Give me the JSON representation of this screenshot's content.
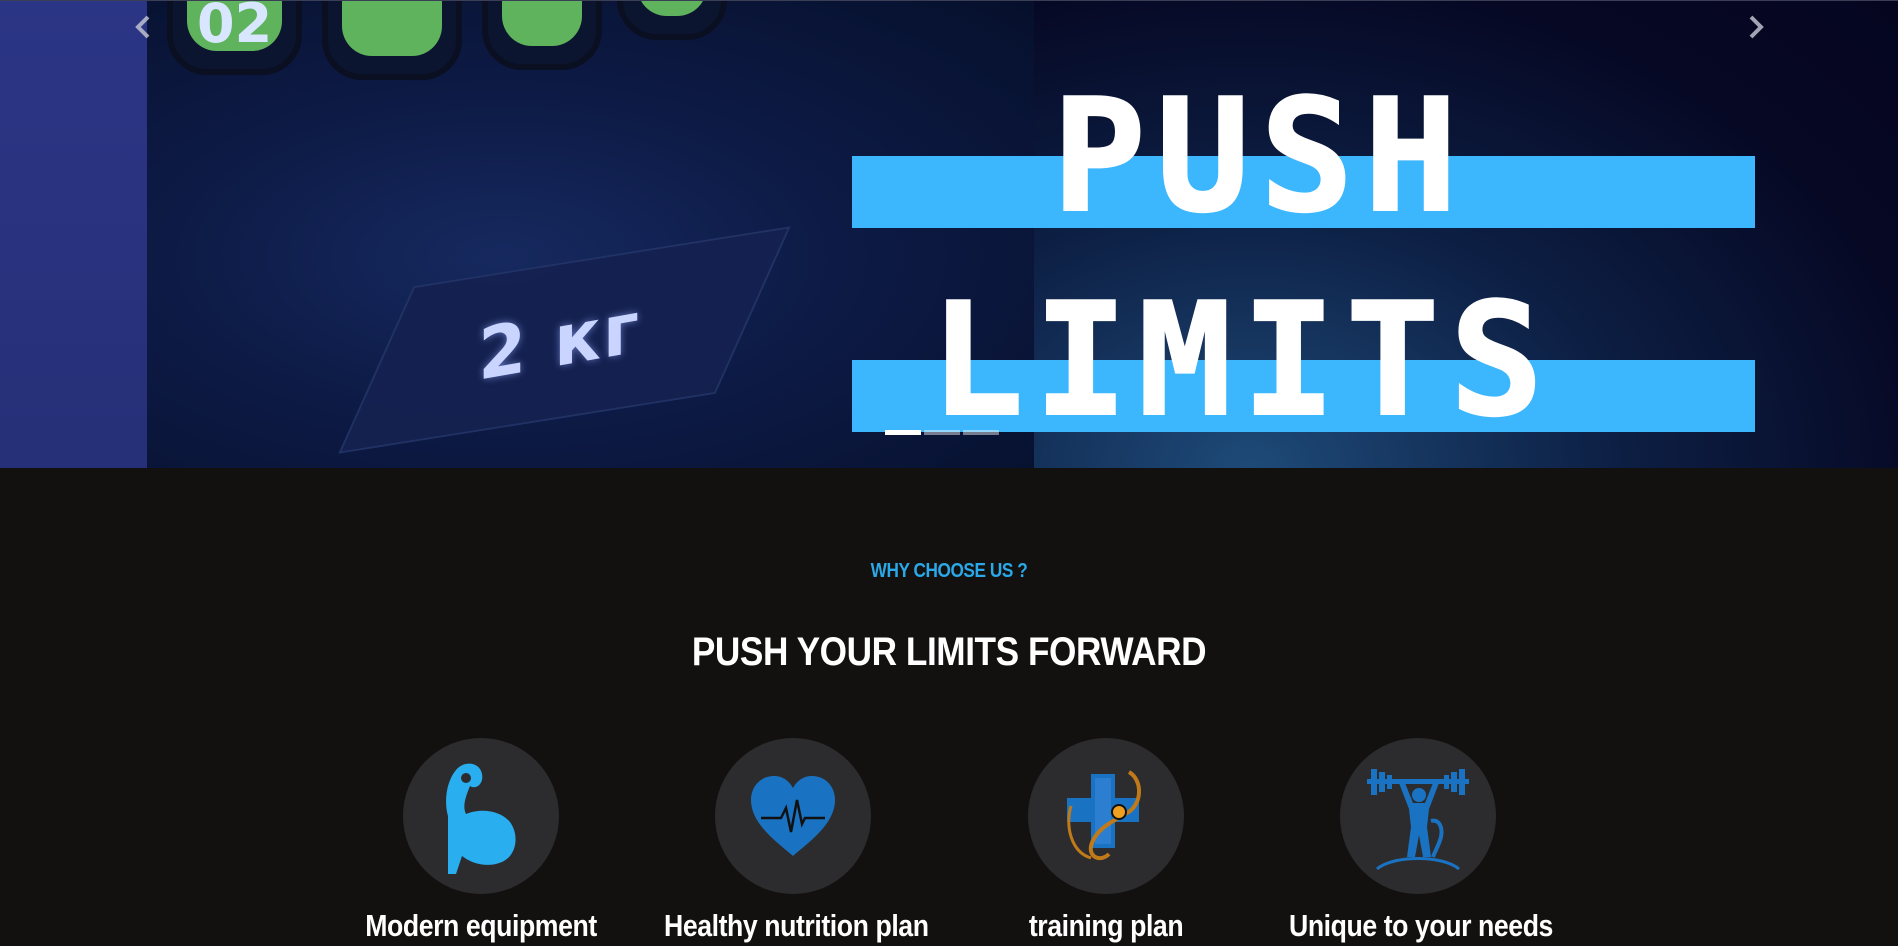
{
  "hero": {
    "headline_line1": "PUSH",
    "headline_line2": "LIMITS",
    "photo_plate_label": "2 кг",
    "photo_plate_number": "02",
    "prev_icon": "chevron-left-icon",
    "next_icon": "chevron-right-icon",
    "slide_count": 3,
    "active_slide": 1,
    "accent_color": "#3cb6fc"
  },
  "why": {
    "eyebrow": "WHY CHOOSE US ?",
    "headline": "PUSH YOUR LIMITS FORWARD",
    "eyebrow_color": "#2aa8e8",
    "features": [
      {
        "title": "Modern equipment",
        "icon": "flexed-arm-icon"
      },
      {
        "title": "Healthy nutrition plan",
        "icon": "heart-pulse-icon"
      },
      {
        "title": "training plan",
        "icon": "medical-cross-stethoscope-icon"
      },
      {
        "title": "Unique to your needs",
        "icon": "weightlifter-icon"
      }
    ]
  }
}
